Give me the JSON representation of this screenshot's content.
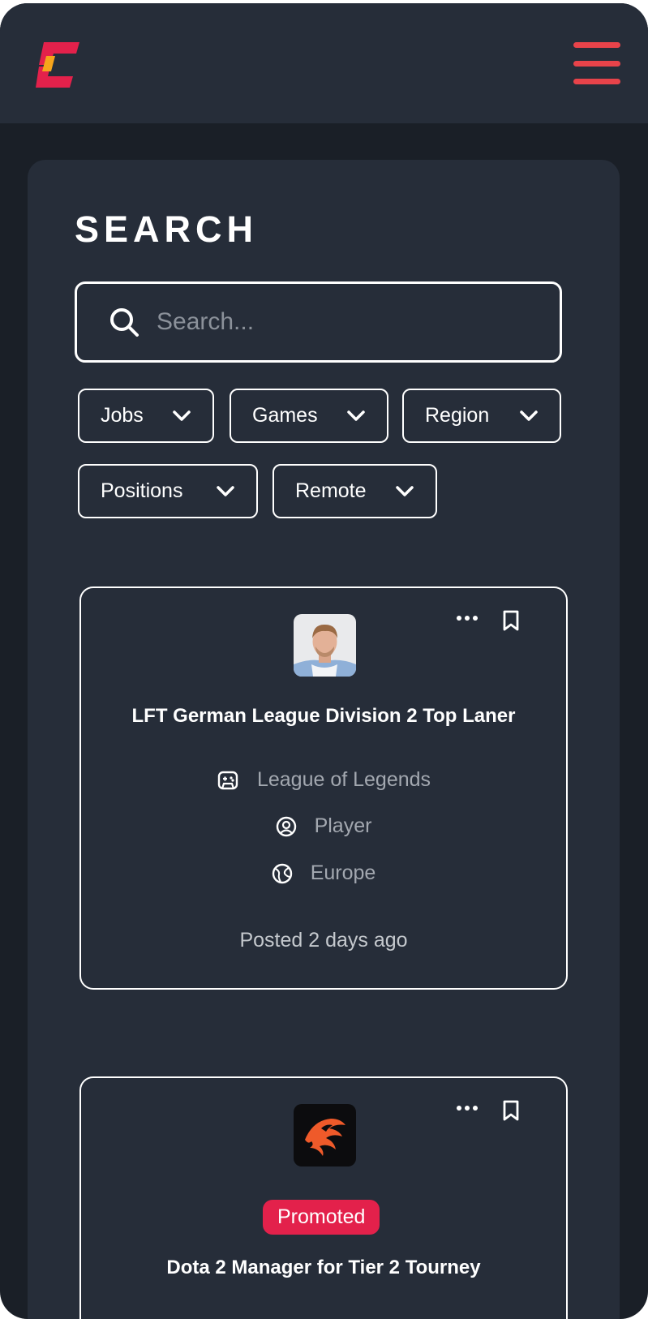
{
  "page": {
    "title": "SEARCH",
    "search": {
      "placeholder": "Search...",
      "value": ""
    }
  },
  "brand": {
    "logo_colors": [
      "#e3214b",
      "#f6a41b"
    ]
  },
  "colors": {
    "accent": "#e8434a",
    "badge": "#e3214b",
    "panel": "#262d39",
    "background": "#1a1f27"
  },
  "filters": [
    {
      "label": "Jobs"
    },
    {
      "label": "Games"
    },
    {
      "label": "Region"
    },
    {
      "label": "Positions"
    },
    {
      "label": "Remote"
    }
  ],
  "cards": [
    {
      "avatar": "player-photo",
      "title": "LFT German League Division 2 Top Laner",
      "game": "League of Legends",
      "role": "Player",
      "region": "Europe",
      "posted": "Posted 2 days ago"
    },
    {
      "avatar": "phoenix-logo",
      "badge": "Promoted",
      "title": "Dota 2 Manager for Tier 2 Tourney"
    }
  ]
}
